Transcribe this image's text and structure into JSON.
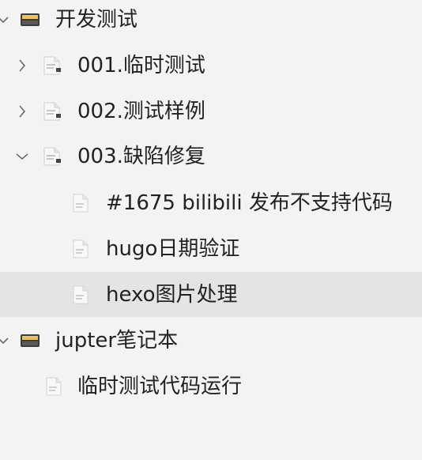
{
  "tree": {
    "items": [
      {
        "label": "开发测试",
        "icon": "notebook-icon",
        "expanded": true
      },
      {
        "label": "001.临时测试",
        "icon": "folder-note-icon",
        "expanded": false
      },
      {
        "label": "002.测试样例",
        "icon": "folder-note-icon",
        "expanded": false
      },
      {
        "label": "003.缺陷修复",
        "icon": "folder-note-icon",
        "expanded": true
      },
      {
        "label": "#1675 bilibili 发布不支持代码",
        "icon": "note-icon"
      },
      {
        "label": "hugo日期验证",
        "icon": "note-icon"
      },
      {
        "label": "hexo图片处理",
        "icon": "note-icon",
        "selected": true
      },
      {
        "label": "jupter笔记本",
        "icon": "notebook-icon",
        "expanded": true
      },
      {
        "label": "临时测试代码运行",
        "icon": "note-icon"
      }
    ]
  }
}
